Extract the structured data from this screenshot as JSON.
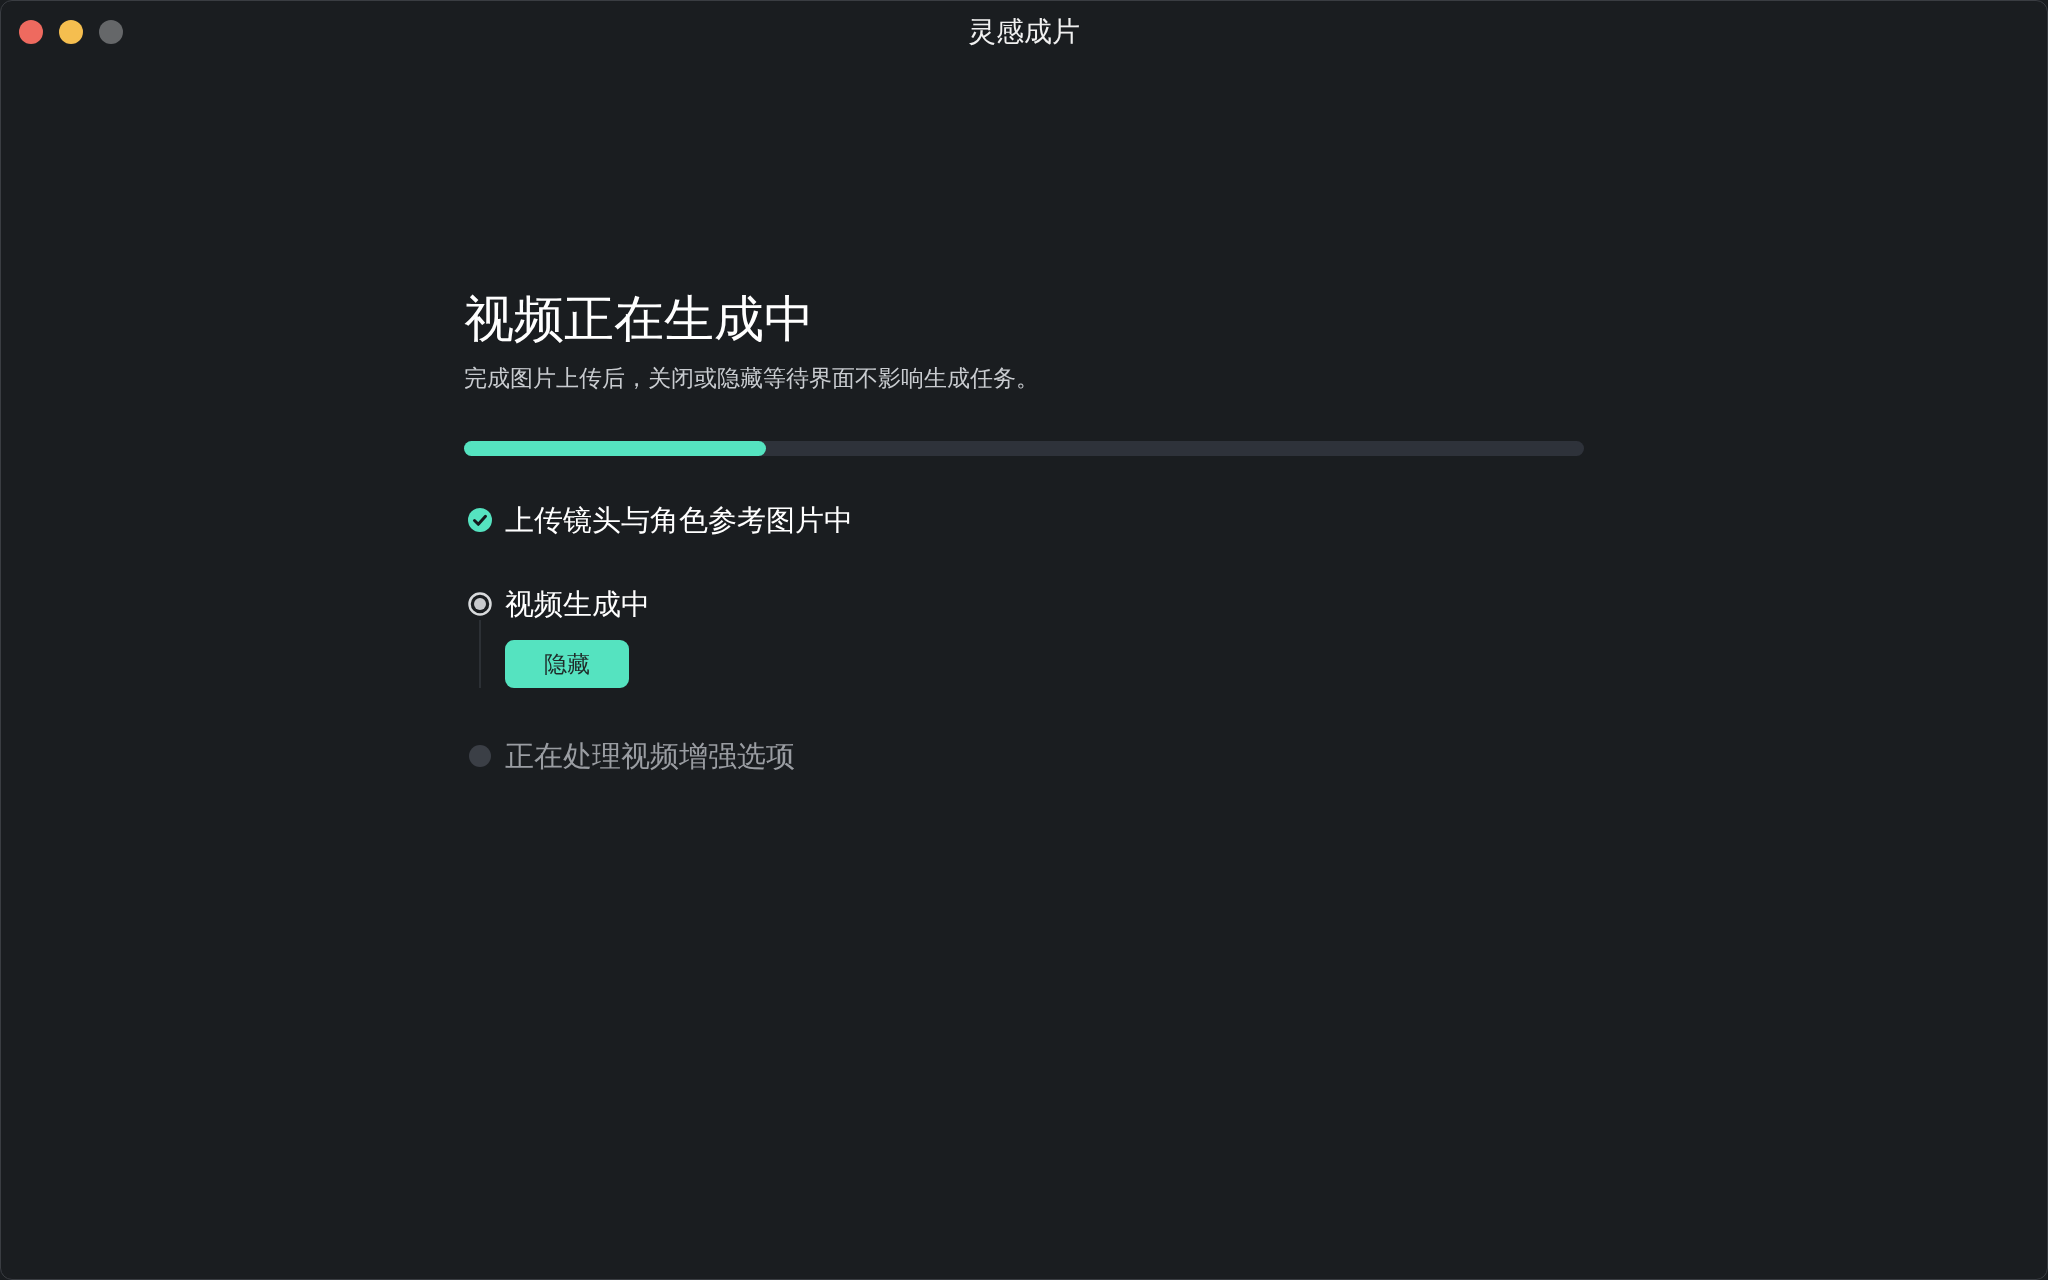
{
  "window": {
    "title": "灵感成片",
    "controls": [
      {
        "kind": "close",
        "disabled": false
      },
      {
        "kind": "minimize",
        "disabled": false
      },
      {
        "kind": "zoom",
        "disabled": true
      }
    ]
  },
  "heading": "视频正在生成中",
  "subtitle": "完成图片上传后，关闭或隐藏等待界面不影响生成任务。",
  "progress": {
    "level": 0.27
  },
  "steps": [
    {
      "label": "上传镜头与角色参考图片中",
      "kind": "done"
    },
    {
      "label": "视频生成中",
      "kind": "active",
      "button": "隐藏"
    },
    {
      "label": "正在处理视频增强选项",
      "kind": "pending"
    }
  ]
}
